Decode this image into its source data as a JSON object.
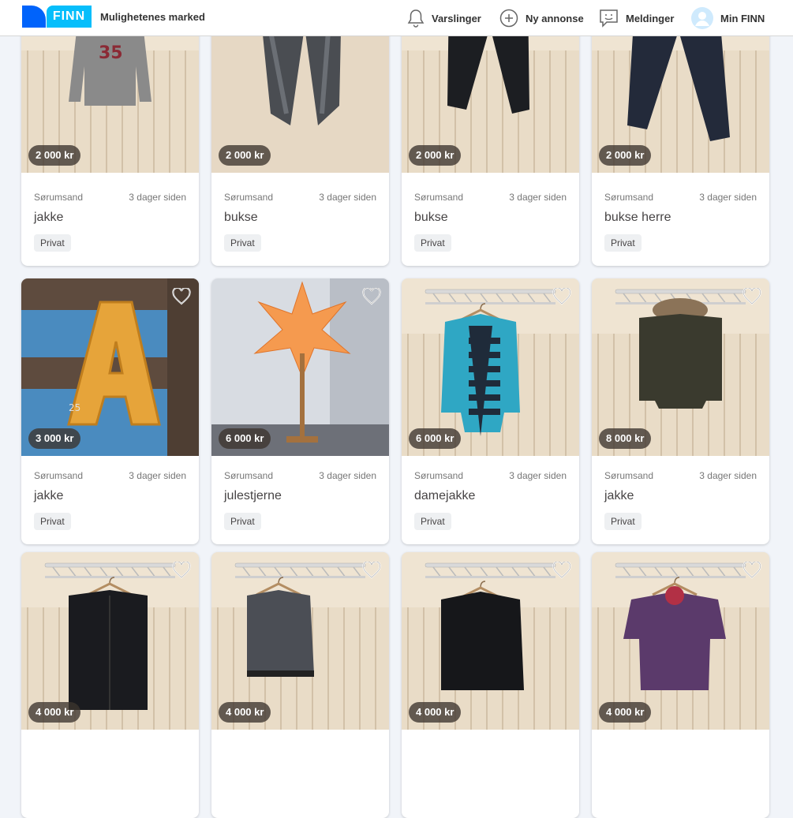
{
  "header": {
    "logo_text": "FINN",
    "tagline": "Mulighetenes marked",
    "nav": {
      "notifications": "Varslinger",
      "new_ad": "Ny annonse",
      "messages": "Meldinger",
      "account": "Min FINN"
    }
  },
  "colors": {
    "brand_blue": "#0063fb",
    "brand_cyan": "#06befb"
  },
  "listings": [
    {
      "price": "2 000 kr",
      "location": "Sørumsand",
      "age": "3 dager siden",
      "title": "jakke",
      "badge": "Privat",
      "image": "grey-hoodie",
      "favorite_visible": false
    },
    {
      "price": "2 000 kr",
      "location": "Sørumsand",
      "age": "3 dager siden",
      "title": "bukse",
      "badge": "Privat",
      "image": "grey-jeans",
      "favorite_visible": false
    },
    {
      "price": "2 000 kr",
      "location": "Sørumsand",
      "age": "3 dager siden",
      "title": "bukse",
      "badge": "Privat",
      "image": "black-jeans",
      "favorite_visible": false
    },
    {
      "price": "2 000 kr",
      "location": "Sørumsand",
      "age": "3 dager siden",
      "title": "bukse herre",
      "badge": "Privat",
      "image": "navy-jeans",
      "favorite_visible": false
    },
    {
      "price": "3 000 kr",
      "location": "Sørumsand",
      "age": "3 dager siden",
      "title": "jakke",
      "badge": "Privat",
      "image": "letter-sweater",
      "favorite_visible": true
    },
    {
      "price": "6 000 kr",
      "location": "Sørumsand",
      "age": "3 dager siden",
      "title": "julestjerne",
      "badge": "Privat",
      "image": "star-lamp",
      "favorite_visible": true
    },
    {
      "price": "6 000 kr",
      "location": "Sørumsand",
      "age": "3 dager siden",
      "title": "damejakke",
      "badge": "Privat",
      "image": "teal-jacket",
      "favorite_visible": true
    },
    {
      "price": "8 000 kr",
      "location": "Sørumsand",
      "age": "3 dager siden",
      "title": "jakke",
      "badge": "Privat",
      "image": "fur-parka",
      "favorite_visible": true
    },
    {
      "price": "4 000 kr",
      "image": "black-cardigan",
      "favorite_visible": true
    },
    {
      "price": "4 000 kr",
      "image": "grey-bomber",
      "favorite_visible": true
    },
    {
      "price": "4 000 kr",
      "image": "black-hoodie",
      "favorite_visible": true
    },
    {
      "price": "4 000 kr",
      "image": "purple-hoodie",
      "favorite_visible": true
    }
  ]
}
